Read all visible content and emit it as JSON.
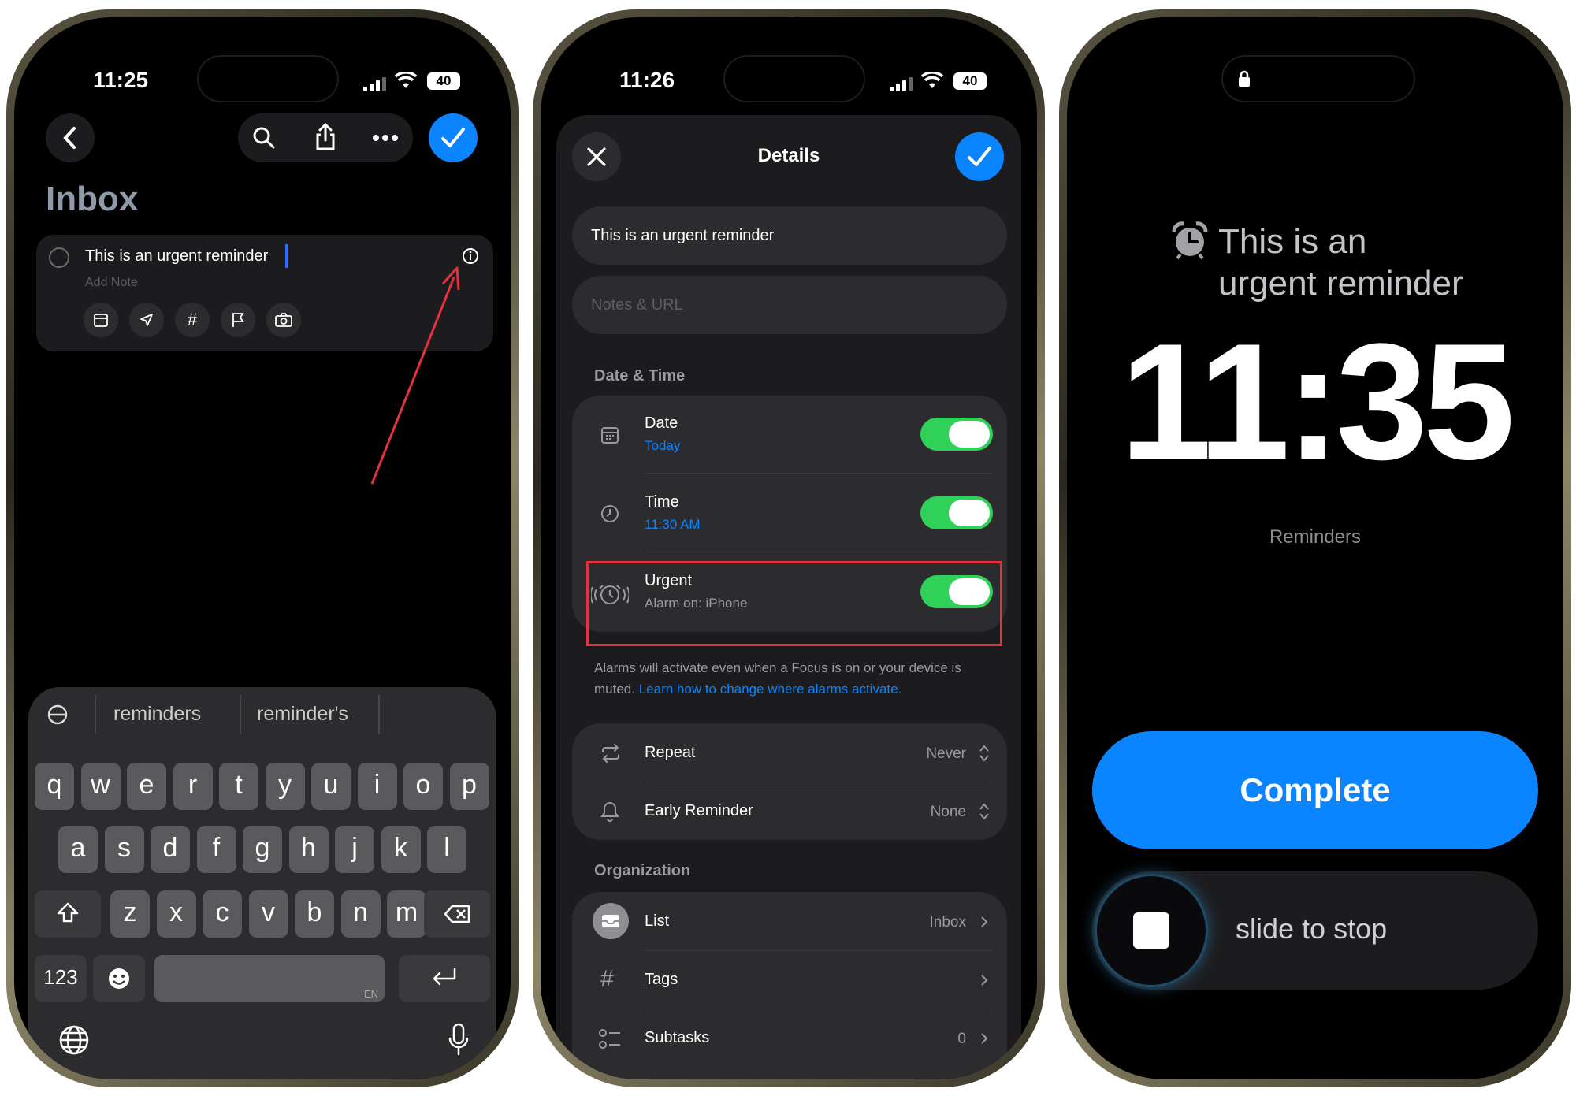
{
  "phone1": {
    "status_time": "11:25",
    "battery": "40",
    "title": "Inbox",
    "reminder_text": "This is an urgent reminder",
    "add_note_placeholder": "Add Note",
    "suggestions": [
      "reminders",
      "reminder's"
    ],
    "keyboard_row1": [
      "q",
      "w",
      "e",
      "r",
      "t",
      "y",
      "u",
      "i",
      "o",
      "p"
    ],
    "keyboard_row2": [
      "a",
      "s",
      "d",
      "f",
      "g",
      "h",
      "j",
      "k",
      "l"
    ],
    "keyboard_row3": [
      "z",
      "x",
      "c",
      "v",
      "b",
      "n",
      "m"
    ],
    "numbers_key": "123",
    "space_lang": "EN"
  },
  "phone2": {
    "status_time": "11:26",
    "battery": "40",
    "sheet_title": "Details",
    "title_field": "This is an urgent reminder",
    "notes_placeholder": "Notes & URL",
    "section_date_time": "Date & Time",
    "date_label": "Date",
    "date_value": "Today",
    "time_label": "Time",
    "time_value": "11:30 AM",
    "urgent_label": "Urgent",
    "urgent_value": "Alarm on: iPhone",
    "footnote": "Alarms will activate even when a Focus is on or your device is muted.",
    "footnote_link": "Learn how to change where alarms activate.",
    "repeat_label": "Repeat",
    "repeat_value": "Never",
    "early_label": "Early Reminder",
    "early_value": "None",
    "section_org": "Organization",
    "list_label": "List",
    "list_value": "Inbox",
    "tags_label": "Tags",
    "subtasks_label": "Subtasks",
    "subtasks_value": "0",
    "toggles": {
      "date": true,
      "time": true,
      "urgent": true
    },
    "accent_color": "#0a84ff",
    "toggle_color": "#30d158",
    "highlight_color": "#e5323e"
  },
  "phone3": {
    "alarm_title_line1": "This is an",
    "alarm_title_line2": "urgent reminder",
    "big_time": "11:35",
    "app_name": "Reminders",
    "complete_label": "Complete",
    "slide_label": "slide to stop"
  }
}
